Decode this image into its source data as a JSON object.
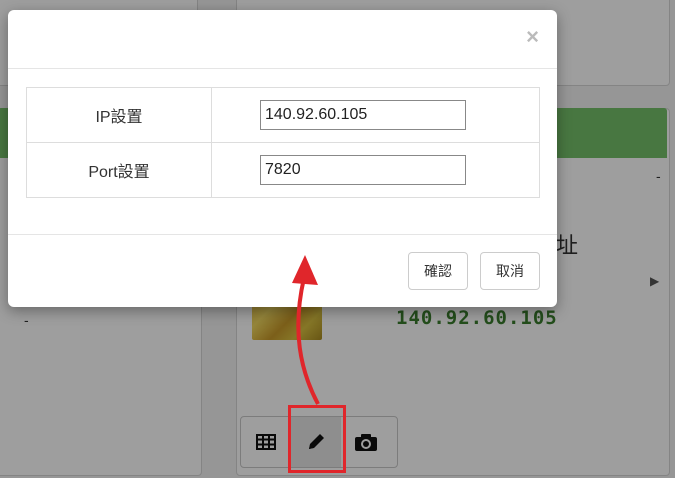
{
  "background": {
    "ip_display": "140.92.60.105",
    "dash_left": "-",
    "dash_right": "-",
    "partial_char": "址",
    "right_arrow": "▶"
  },
  "toolbar": {
    "table_icon": "table-icon",
    "edit_icon": "pencil-icon",
    "camera_icon": "camera-icon"
  },
  "modal": {
    "close_glyph": "×",
    "rows": [
      {
        "label": "IP設置",
        "value": "140.92.60.105"
      },
      {
        "label": "Port設置",
        "value": "7820"
      }
    ],
    "confirm_label": "確認",
    "cancel_label": "取消"
  },
  "colors": {
    "highlight": "#e0262b",
    "accent_green": "#74c06a",
    "ip_text": "#3a7f2e"
  }
}
